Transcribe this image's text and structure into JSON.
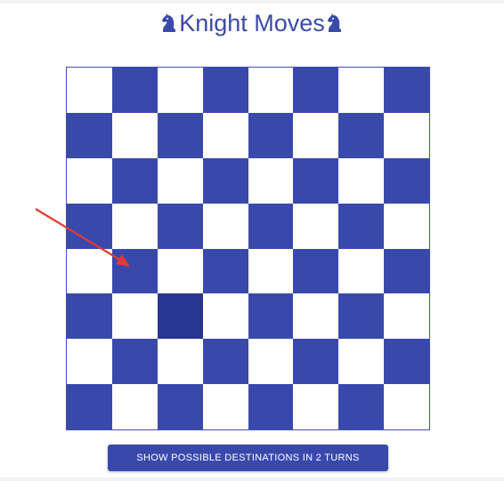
{
  "header": {
    "title": "Knight Moves",
    "left_icon": "knight-icon",
    "right_icon": "knight-icon"
  },
  "board": {
    "rows": 8,
    "columns": 8,
    "dark_color": "#3949ab",
    "light_color": "#ffffff",
    "selected_color": "#283593",
    "top_left_square": "light",
    "selected_square": {
      "row": 5,
      "col": 2
    }
  },
  "annotation": {
    "icon": "red-arrow-icon",
    "color": "#e53935"
  },
  "actions": {
    "show_destinations_label": "SHOW POSSIBLE DESTINATIONS IN 2 TURNS"
  }
}
